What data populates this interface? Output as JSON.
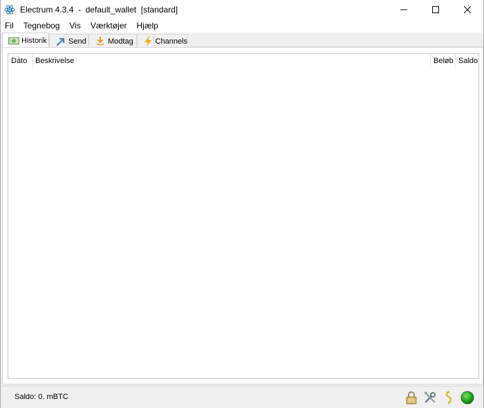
{
  "window": {
    "title": "Electrum 4.3.4  -  default_wallet  [standard]",
    "minimize_label": "—",
    "maximize_label": "☐",
    "close_label": "✕"
  },
  "menu": [
    "Fil",
    "Tegnebog",
    "Vis",
    "Værktøjer",
    "Hjælp"
  ],
  "tabs": [
    {
      "label": "Historik",
      "icon": "money-icon",
      "active": true
    },
    {
      "label": "Send",
      "icon": "send-arrow-icon",
      "active": false
    },
    {
      "label": "Modtag",
      "icon": "receive-icon",
      "active": false
    },
    {
      "label": "Channels",
      "icon": "lightning-icon",
      "active": false
    }
  ],
  "history_table": {
    "columns": [
      "Dato",
      "Beskrivelse",
      "Beløb",
      "Saldo"
    ],
    "sort_indicator": "^",
    "rows": []
  },
  "status": {
    "balance_text": "Saldo: 0. mBTC",
    "icons": [
      "lock-icon",
      "tools-icon",
      "seed-icon",
      "network-status-icon"
    ],
    "network_color": "#22a822"
  },
  "colors": {
    "electrum_blue": "#2d7fbf",
    "lightning": "#f5a623"
  }
}
